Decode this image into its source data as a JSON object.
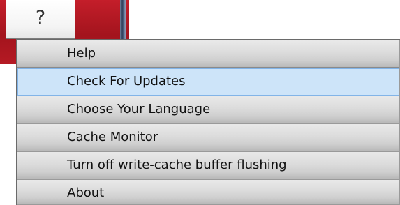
{
  "toolbar": {
    "help_button_label": "?",
    "accent_color": "#c41e2a"
  },
  "menu": {
    "highlight_color": "#cde4f9",
    "items": [
      {
        "label": "Help",
        "highlighted": false
      },
      {
        "label": "Check For Updates",
        "highlighted": true
      },
      {
        "label": "Choose Your Language",
        "highlighted": false
      },
      {
        "label": "Cache Monitor",
        "highlighted": false
      },
      {
        "label": "Turn off write-cache buffer flushing",
        "highlighted": false
      },
      {
        "label": "About",
        "highlighted": false
      }
    ]
  }
}
